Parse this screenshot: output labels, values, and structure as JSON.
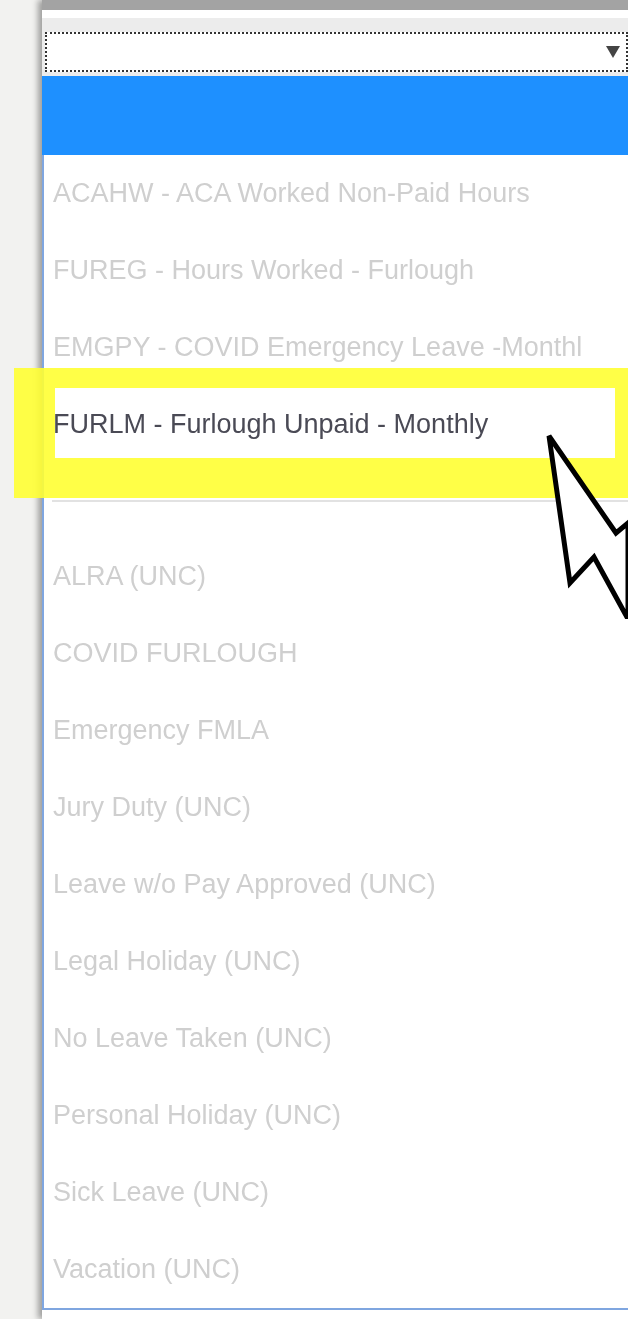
{
  "option_groups": [
    [
      {
        "label": "ACAHW - ACA Worked Non-Paid Hours",
        "disabled": true,
        "highlighted": false
      },
      {
        "label": "FUREG - Hours Worked - Furlough",
        "disabled": true,
        "highlighted": false
      },
      {
        "label": "EMGPY - COVID Emergency Leave -Monthl",
        "disabled": true,
        "highlighted": false
      },
      {
        "label": "FURLM - Furlough Unpaid - Monthly",
        "disabled": false,
        "highlighted": true
      }
    ],
    [
      {
        "label": "ALRA (UNC)",
        "disabled": true,
        "highlighted": false
      },
      {
        "label": "COVID FURLOUGH",
        "disabled": true,
        "highlighted": false
      },
      {
        "label": "Emergency FMLA",
        "disabled": true,
        "highlighted": false
      },
      {
        "label": "Jury Duty (UNC)",
        "disabled": true,
        "highlighted": false
      },
      {
        "label": "Leave w/o Pay Approved (UNC)",
        "disabled": true,
        "highlighted": false
      },
      {
        "label": "Legal Holiday (UNC)",
        "disabled": true,
        "highlighted": false
      },
      {
        "label": "No Leave Taken (UNC)",
        "disabled": true,
        "highlighted": false
      },
      {
        "label": "Personal Holiday (UNC)",
        "disabled": true,
        "highlighted": false
      },
      {
        "label": "Sick Leave (UNC)",
        "disabled": true,
        "highlighted": false
      },
      {
        "label": "Vacation (UNC)",
        "disabled": true,
        "highlighted": false
      }
    ]
  ]
}
